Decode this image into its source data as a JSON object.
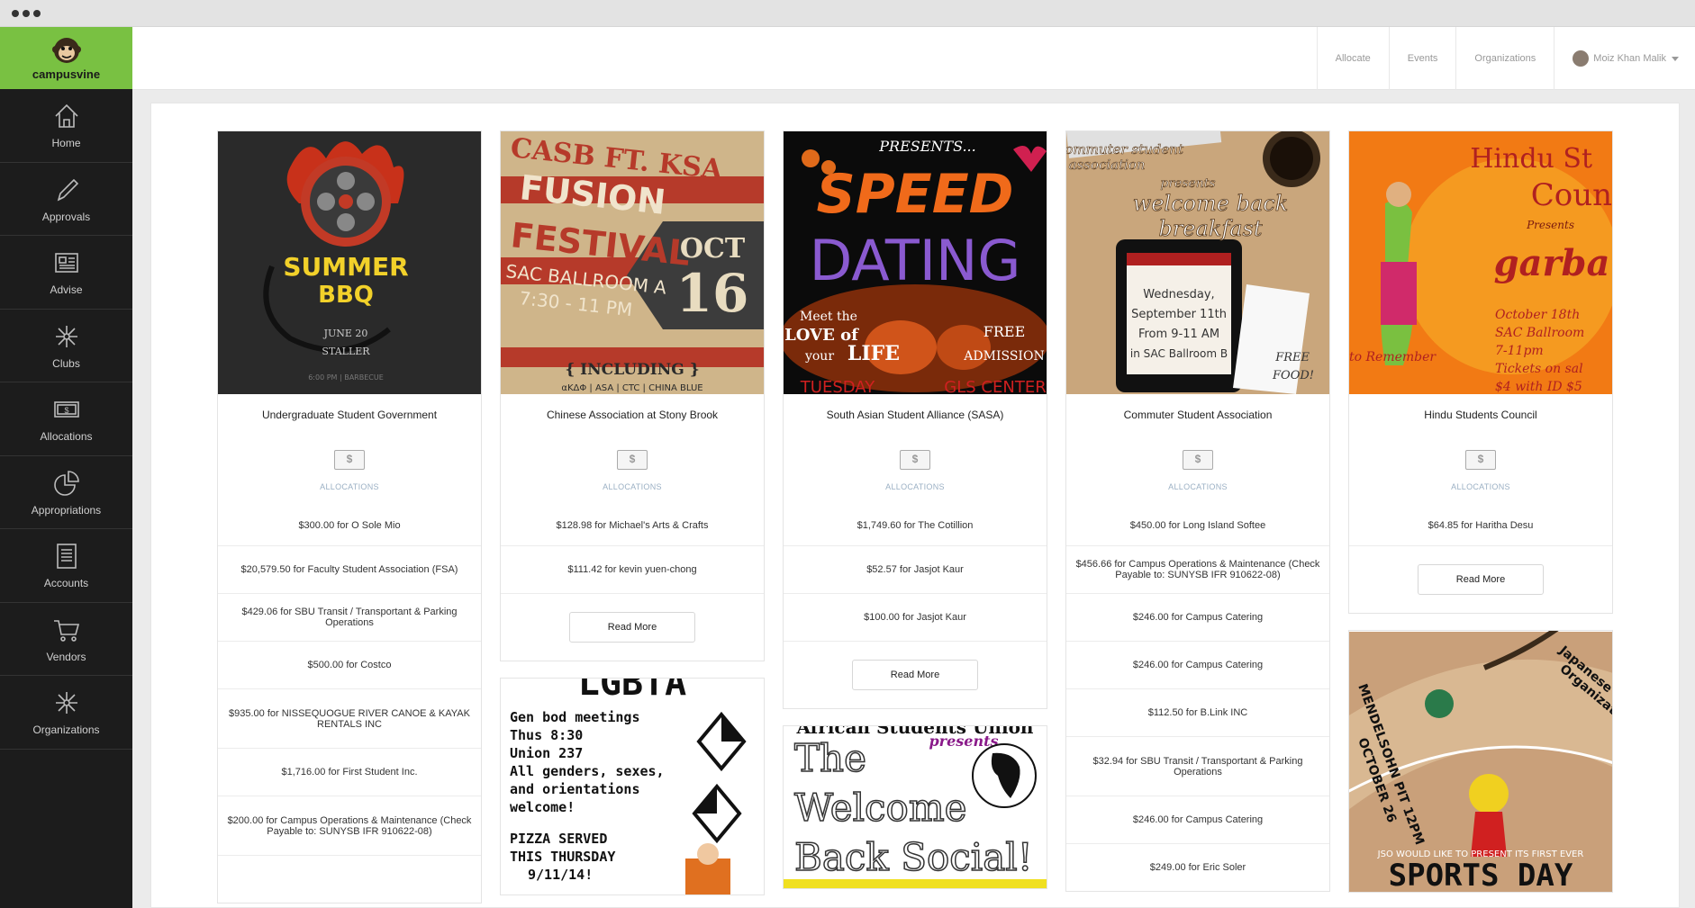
{
  "brand": {
    "name": "campusvine"
  },
  "sidebar": {
    "items": [
      {
        "label": "Home",
        "icon": "home-icon"
      },
      {
        "label": "Approvals",
        "icon": "pen-icon"
      },
      {
        "label": "Advise",
        "icon": "newspaper-icon"
      },
      {
        "label": "Clubs",
        "icon": "network-icon"
      },
      {
        "label": "Allocations",
        "icon": "money-icon"
      },
      {
        "label": "Appropriations",
        "icon": "pie-chart-icon"
      },
      {
        "label": "Accounts",
        "icon": "ledger-icon"
      },
      {
        "label": "Vendors",
        "icon": "cart-icon"
      },
      {
        "label": "Organizations",
        "icon": "network-icon"
      }
    ]
  },
  "topnav": {
    "allocate": "Allocate",
    "events": "Events",
    "organizations": "Organizations",
    "user": "Moiz Khan Malik"
  },
  "labels": {
    "allocations": "ALLOCATIONS",
    "read_more": "Read More"
  },
  "cards": [
    {
      "org": "Undergraduate Student Government",
      "poster_text": [
        "SUMMER",
        "BBQ",
        "JUNE 20",
        "STALLER",
        "6:00 PM | BARBECUE"
      ],
      "allocations": [
        "$300.00 for O Sole Mio",
        "$20,579.50 for Faculty Student Association (FSA)",
        "$429.06 for SBU Transit / Transportant & Parking Operations",
        "$500.00 for Costco",
        "$935.00 for NISSEQUOGUE RIVER CANOE & KAYAK RENTALS INC",
        "$1,716.00 for First Student Inc.",
        "$200.00 for Campus Operations & Maintenance (Check Payable to: SUNYSB IFR 910622-08)"
      ]
    },
    {
      "org": "Chinese Association at Stony Brook",
      "poster_text": [
        "CASB FT. KSA",
        "FUSION",
        "FESTIVAL",
        "SAC BALLROOM A",
        "7:30 - 11 PM",
        "OCT",
        "16",
        "{ INCLUDING }",
        "αKΔΦ | ASA | CTC | CHINA BLUE"
      ],
      "allocations": [
        "$128.98 for Michael's Arts & Crafts",
        "$111.42 for kevin yuen-chong"
      ]
    },
    {
      "org": "South Asian Student Alliance (SASA)",
      "poster_text": [
        "PRESENTS...",
        "SPEED",
        "DATING",
        "Meet the",
        "LOVE of",
        "your",
        "LIFE",
        "FREE",
        "ADMISSION",
        "TUESDAY",
        "GLS CENTER"
      ],
      "allocations": [
        "$1,749.60 for The Cotillion",
        "$52.57 for Jasjot Kaur",
        "$100.00 for Jasjot Kaur"
      ]
    },
    {
      "org": "Commuter Student Association",
      "poster_text": [
        "commuter student",
        "association",
        "presents",
        "welcome back",
        "breakfast",
        "Wednesday,",
        "September 11th",
        "From 9-11 AM",
        "in SAC Ballroom B",
        "FREE",
        "FOOD!"
      ],
      "allocations": [
        "$450.00 for Long Island Softee",
        "$456.66 for Campus Operations & Maintenance (Check Payable to: SUNYSB IFR 910622-08)",
        "$246.00 for Campus Catering",
        "$246.00 for Campus Catering",
        "$112.50 for B.Link INC",
        "$32.94 for SBU Transit / Transportant & Parking Operations",
        "$246.00 for Campus Catering",
        "$249.00 for Eric Soler"
      ]
    },
    {
      "org": "Hindu Students Council",
      "poster_text": [
        "Hindu St",
        "Coun",
        "Presents",
        "garba",
        "October 18th",
        "SAC Ballroom",
        "7-11pm",
        "Tickets on sal",
        "$4 with ID $5",
        "to Remember"
      ],
      "allocations": [
        "$64.85 for Haritha Desu"
      ]
    }
  ],
  "extra_posters": {
    "lgbta": [
      "LGBTA",
      "Gen bod meetings",
      "Thus 8:30",
      "Union 237",
      "All genders, sexes,",
      "and orientations",
      "welcome!",
      "PIZZA SERVED",
      "THIS THURSDAY",
      "9/11/14!"
    ],
    "african": [
      "African Students Union",
      "presents",
      "The",
      "Welcome",
      "Back Social!",
      "AFRICAN STUDENTS UNION"
    ],
    "japanese": [
      "Japanese Stu",
      "Organization",
      "MENDELSOHN PIT 12PM",
      "OCTOBER 26",
      "JSO WOULD LIKE TO PRESENT ITS FIRST EVER",
      "SPORTS DAY"
    ]
  },
  "colors": {
    "brand_green": "#79c142",
    "sidebar": "#1c1c1c",
    "muted_blue": "#9bb0c4"
  }
}
